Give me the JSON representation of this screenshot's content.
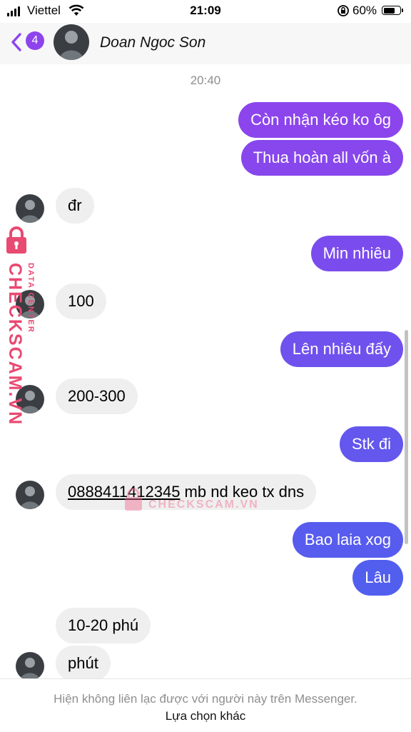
{
  "status_bar": {
    "carrier": "Viettel",
    "time": "21:09",
    "battery": "60%"
  },
  "header": {
    "back_count": "4",
    "contact_name": "Doan Ngoc Son"
  },
  "conversation": {
    "timestamp": "20:40",
    "messages": [
      {
        "from": "me",
        "text": "Còn nhận kéo ko ôg"
      },
      {
        "from": "me",
        "text": "Thua hoàn all vốn à"
      },
      {
        "from": "them",
        "text": "đr"
      },
      {
        "from": "me",
        "text": "Min nhiêu"
      },
      {
        "from": "them",
        "text": "100"
      },
      {
        "from": "me",
        "text": "Lên nhiêu đấy"
      },
      {
        "from": "them",
        "text": "200-300"
      },
      {
        "from": "me",
        "text": "Stk đi"
      },
      {
        "from": "them",
        "number": "0888411412345",
        "text": " mb nd keo tx dns"
      },
      {
        "from": "me",
        "text": "Bao laia xog"
      },
      {
        "from": "me",
        "text": "Lâu"
      },
      {
        "from": "them",
        "text": "10-20 phú"
      },
      {
        "from": "them",
        "text": "phút"
      }
    ]
  },
  "watermark": {
    "brand": "CHECKSCAM.VN",
    "sub": "DATA CENTER",
    "center": "CHECKSCAM.VN"
  },
  "footer": {
    "notice": "Hiện không liên lạc được với người này trên Messenger.",
    "other_choice": "Lựa chọn khác"
  },
  "colors": {
    "bubble_top": "#8e44ec",
    "bubble_bottom": "#4a62ee",
    "incoming": "#efefef",
    "watermark": "#e84a72"
  }
}
